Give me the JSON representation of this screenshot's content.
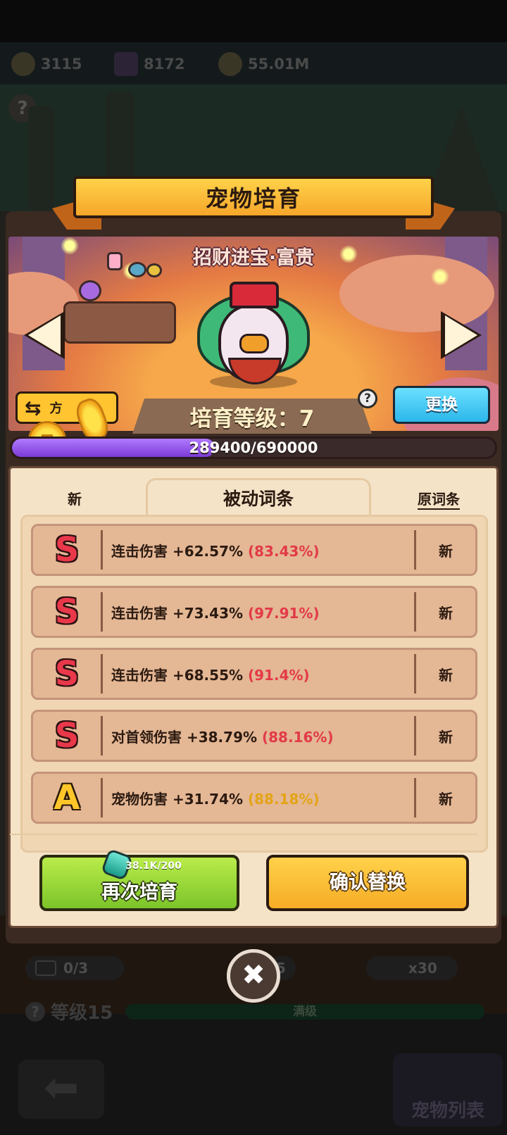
{
  "resources": [
    {
      "icon": "egg-icon",
      "value": "3115"
    },
    {
      "icon": "purple-gem-icon",
      "value": "8172"
    },
    {
      "icon": "gold-coin-icon",
      "value": "55.01M"
    }
  ],
  "background": {
    "video_count": "0/3",
    "partial_count": "5",
    "egg_count": "x30",
    "level_label": "等级15",
    "level_bar_text": "满级",
    "pet_list_label": "宠物列表"
  },
  "modal": {
    "title": "宠物培育",
    "pet_name": "招财进宝·富贵",
    "scheme_label": "方",
    "level_text": "培育等级：7",
    "help_symbol": "?",
    "replace_label": "更换",
    "xp": {
      "current": 289400,
      "max": 690000,
      "text": "289400/690000"
    }
  },
  "tabs": {
    "new": "新",
    "passive": "被动词条",
    "original": "原词条"
  },
  "attributes": [
    {
      "grade": "S",
      "name": "连击伤害",
      "value": "+62.57%",
      "roll": "(83.43%)",
      "tag": "新"
    },
    {
      "grade": "S",
      "name": "连击伤害",
      "value": "+73.43%",
      "roll": "(97.91%)",
      "tag": "新"
    },
    {
      "grade": "S",
      "name": "连击伤害",
      "value": "+68.55%",
      "roll": "(91.4%)",
      "tag": "新"
    },
    {
      "grade": "S",
      "name": "对首领伤害",
      "value": "+38.79%",
      "roll": "(88.16%)",
      "tag": "新"
    },
    {
      "grade": "A",
      "name": "宠物伤害",
      "value": "+31.74%",
      "roll": "(88.18%)",
      "tag": "新"
    }
  ],
  "actions": {
    "again_label": "再次培育",
    "again_cost": "38.1K/200",
    "confirm_label": "确认替换",
    "close_symbol": "✖"
  },
  "colors": {
    "grade_s": "#e8384a",
    "grade_a": "#ffc62a",
    "accent_green": "#7cc42a",
    "accent_orange": "#f6ac26",
    "xp_purple": "#7a3ad6"
  }
}
